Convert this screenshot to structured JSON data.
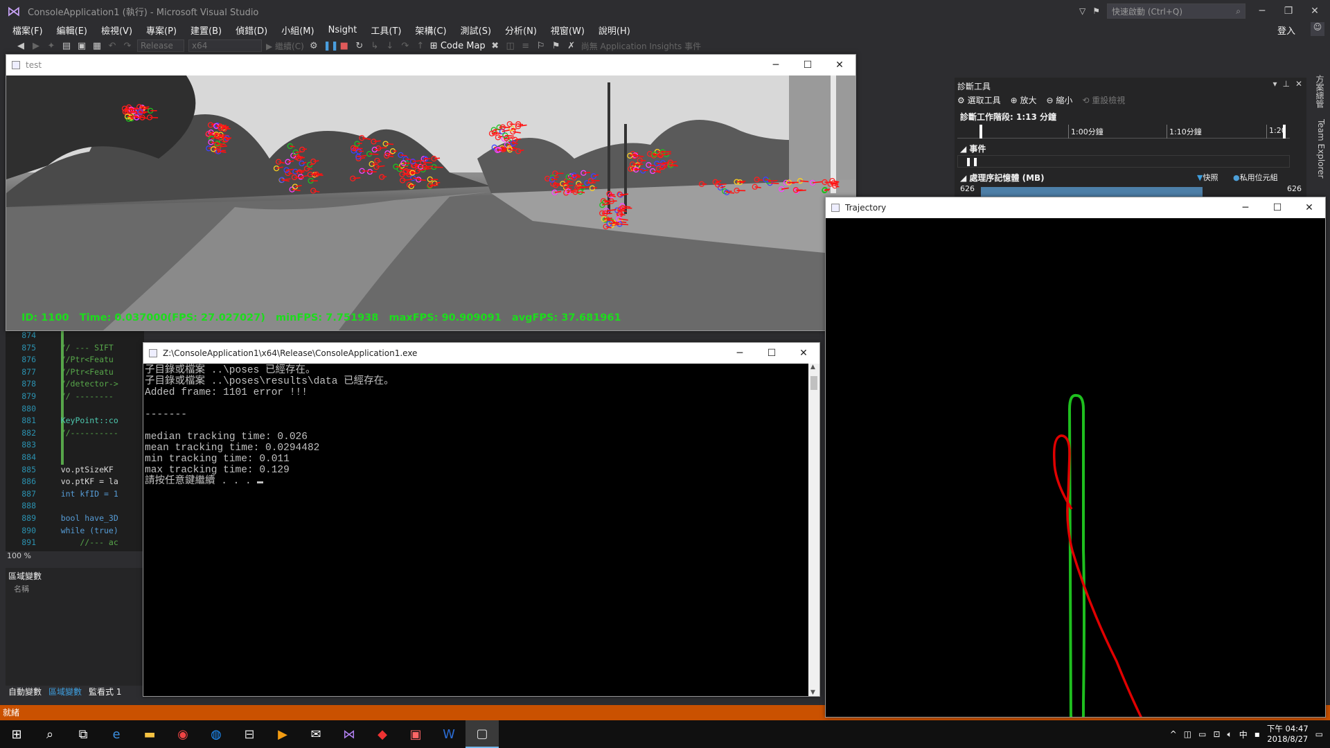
{
  "vs": {
    "title": "ConsoleApplication1 (執行) - Microsoft Visual Studio",
    "quick_launch": "快速啟動 (Ctrl+Q)",
    "login": "登入",
    "menu": [
      "檔案(F)",
      "編輯(E)",
      "檢視(V)",
      "專案(P)",
      "建置(B)",
      "偵錯(D)",
      "小組(M)",
      "Nsight",
      "工具(T)",
      "架構(C)",
      "測試(S)",
      "分析(N)",
      "視窗(W)",
      "說明(H)"
    ],
    "toolbar": {
      "config": "Release",
      "platform": "x64",
      "continue": "繼續(C)",
      "codemap": "Code Map",
      "insights": "尚無 Application Insights 事件"
    },
    "editor": {
      "zoom": "100 %",
      "lines": [
        {
          "n": "874",
          "text": ""
        },
        {
          "n": "875",
          "text": "    // --- SIFT"
        },
        {
          "n": "876",
          "text": "    //Ptr<Featu"
        },
        {
          "n": "877",
          "text": "    //Ptr<Featu"
        },
        {
          "n": "878",
          "text": "    //detector->"
        },
        {
          "n": "879",
          "text": "    // --------"
        },
        {
          "n": "880",
          "text": ""
        },
        {
          "n": "881",
          "text": "    KeyPoint::co"
        },
        {
          "n": "882",
          "text": "    //----------"
        },
        {
          "n": "883",
          "text": ""
        },
        {
          "n": "884",
          "text": ""
        },
        {
          "n": "885",
          "text": "    vo.ptSizeKF"
        },
        {
          "n": "886",
          "text": "    vo.ptKF = la"
        },
        {
          "n": "887",
          "text": "    int kfID = 1"
        },
        {
          "n": "888",
          "text": ""
        },
        {
          "n": "889",
          "text": "    bool have_3D"
        },
        {
          "n": "890",
          "text": "    while (true)"
        },
        {
          "n": "891",
          "text": "        //--- ac"
        }
      ]
    },
    "locals": {
      "title": "區域變數",
      "column": "名稱"
    },
    "debug_tabs": [
      "自動變數",
      "區域變數",
      "監看式 1"
    ],
    "status": "就緒"
  },
  "diagnostics": {
    "title": "診斷工具",
    "tools": [
      "選取工具",
      "放大",
      "縮小",
      "重設檢視"
    ],
    "session": "診斷工作階段: 1:13 分鐘",
    "ruler": [
      "1:00分鐘",
      "1:10分鐘",
      "1:20"
    ],
    "events": "事件",
    "memory": "處理序記憶體 (MB)",
    "legend_snapshot": "快照",
    "legend_private": "私用位元組",
    "mem_left": "626",
    "mem_right": "626"
  },
  "side_tabs": [
    "方案總管",
    "Team Explorer"
  ],
  "test_window": {
    "title": "test",
    "stats": "ID: 1100   Time: 0.037000(FPS: 27.027027)   minFPS: 7.751938   maxFPS: 90.909091   avgFPS: 37.681961"
  },
  "console_window": {
    "title": "Z:\\ConsoleApplication1\\x64\\Release\\ConsoleApplication1.exe",
    "lines": [
      "子目錄或檔案 ..\\poses 已經存在。",
      "子目錄或檔案 ..\\poses\\results\\data 已經存在。",
      "Added frame: 1101 error !!!",
      "",
      "-------",
      "",
      "median tracking time: 0.026",
      "mean tracking time: 0.0294482",
      "min tracking time: 0.011",
      "max tracking time: 0.129",
      "請按任意鍵繼續 . . . "
    ]
  },
  "trajectory_window": {
    "title": "Trajectory",
    "ground_truth_color": "#1fbf1f",
    "estimate_color": "#e00000"
  },
  "taskbar": {
    "time": "下午 04:47",
    "date": "2018/8/27",
    "ime": "中"
  }
}
